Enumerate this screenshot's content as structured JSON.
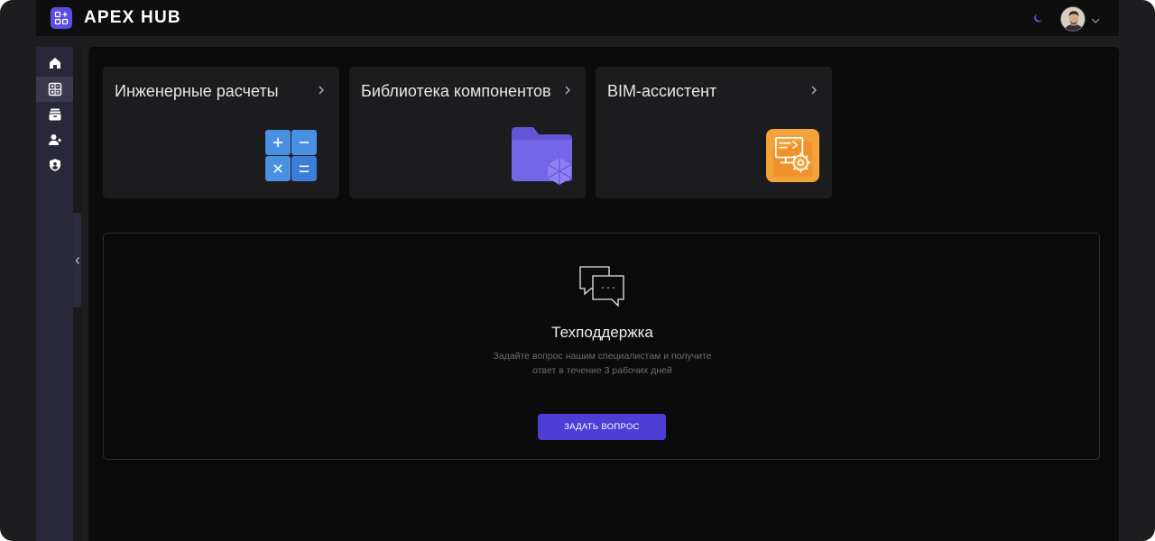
{
  "app": {
    "brand": "APEX HUB",
    "accent_color": "#5b4ee0"
  },
  "header": {
    "theme_icon": "moon-icon",
    "user_menu_icon": "chevron-down-icon"
  },
  "sidebar": {
    "items": [
      {
        "id": "home",
        "icon": "home-icon"
      },
      {
        "id": "calculations",
        "icon": "calculator-icon",
        "active": true
      },
      {
        "id": "library",
        "icon": "archive-icon"
      },
      {
        "id": "users",
        "icon": "user-add-icon"
      },
      {
        "id": "security",
        "icon": "shield-user-icon"
      }
    ],
    "collapse_icon": "chevron-left-icon"
  },
  "cards": [
    {
      "title": "Инженерные расчеты",
      "icon": "calculator-tile-icon"
    },
    {
      "title": "Библиотека компонентов",
      "icon": "folder-component-icon"
    },
    {
      "title": "BIM-ассистент",
      "icon": "bim-settings-icon"
    }
  ],
  "support": {
    "icon": "chat-bubbles-icon",
    "title": "Техподдержка",
    "description_line1": "Задайте вопрос нашим специалистам и получите",
    "description_line2": "ответ в течение 3 рабочих дней",
    "button_label": "ЗАДАТЬ ВОПРОС",
    "button_color": "#4f3ed6"
  }
}
